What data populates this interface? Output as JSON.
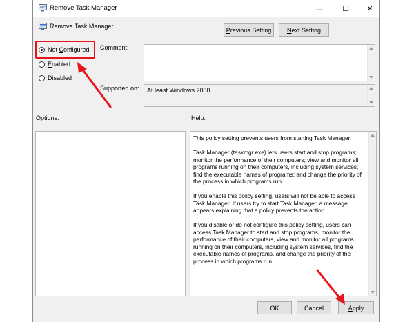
{
  "window": {
    "title": "Remove Task Manager",
    "minimize_glyph": "—",
    "maximize_glyph": "☐",
    "close_glyph": "✕"
  },
  "header": {
    "policy_title": "Remove Task Manager",
    "prev_label_u": "P",
    "prev_label_rest": "revious Setting",
    "next_label_u": "N",
    "next_label_rest": "ext Setting"
  },
  "state": {
    "options": [
      {
        "label_pre": "Not ",
        "label_u": "C",
        "label_post": "onfigured",
        "selected": true
      },
      {
        "label_pre": "",
        "label_u": "E",
        "label_post": "nabled",
        "selected": false
      },
      {
        "label_pre": "",
        "label_u": "D",
        "label_post": "isabled",
        "selected": false
      }
    ]
  },
  "comment": {
    "label": "Comment:",
    "value": ""
  },
  "supported": {
    "label": "Supported on:",
    "value": "At least Windows 2000"
  },
  "options_panel": {
    "label": "Options:"
  },
  "help_panel": {
    "label": "Help:",
    "paragraphs": [
      "This policy setting prevents users from starting Task Manager.",
      "Task Manager (taskmgr.exe) lets users start and stop programs; monitor the performance of their computers; view and monitor all programs running on their computers, including system services; find the executable names of programs; and change the priority of the process in which programs run.",
      "If you enable this policy setting, users will not be able to access Task Manager. If users try to start Task Manager, a message appears explaining that a policy prevents the action.",
      "If you disable or do not configure this policy setting, users can access Task Manager to  start and stop programs, monitor the performance of their computers, view and monitor all programs running on their computers, including system services, find the executable names of programs, and change the priority of the process in which programs run."
    ]
  },
  "footer": {
    "ok_label": "OK",
    "cancel_label": "Cancel",
    "apply_label_u": "A",
    "apply_label_rest": "pply"
  },
  "annotation": {
    "highlight_color": "#e8141c",
    "icons": [
      "arrow-annotation-icon",
      "arrow-annotation-icon"
    ]
  }
}
